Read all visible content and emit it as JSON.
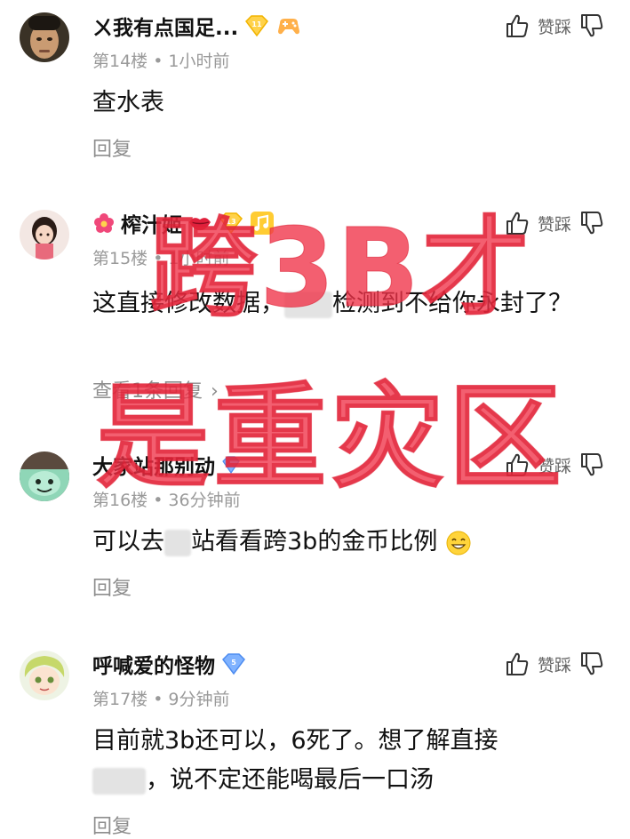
{
  "vote": {
    "label": "赞踩"
  },
  "comments": [
    {
      "username": "ㄨ我有点国足...",
      "level_badge": "11",
      "floor": "第14楼",
      "time": "1小时前",
      "text": "查水表",
      "reply_label": "回复"
    },
    {
      "username": "榨汁姬",
      "level_badge": "13",
      "floor": "第15楼",
      "time": "1小时前",
      "text_before": "这直接修改数据，",
      "text_after": "检测到不给你永封了？",
      "reply_label": "查看1条回复"
    },
    {
      "username": "大家站那别动",
      "floor": "第16楼",
      "time": "36分钟前",
      "text_before": "可以去",
      "text_after": "站看看跨3b的金币比例",
      "reply_label": "回复"
    },
    {
      "username": "呼喊爱的怪物",
      "level_badge": "5",
      "floor": "第17楼",
      "time": "9分钟前",
      "text_line1": "目前就3b还可以，6死了。想了解直接",
      "text_line2": "，说不定还能喝最后一口汤",
      "reply_label": "回复"
    }
  ],
  "overlay": {
    "line1": "跨3B才",
    "line2": "是重灾区",
    "color": "#f03248"
  }
}
